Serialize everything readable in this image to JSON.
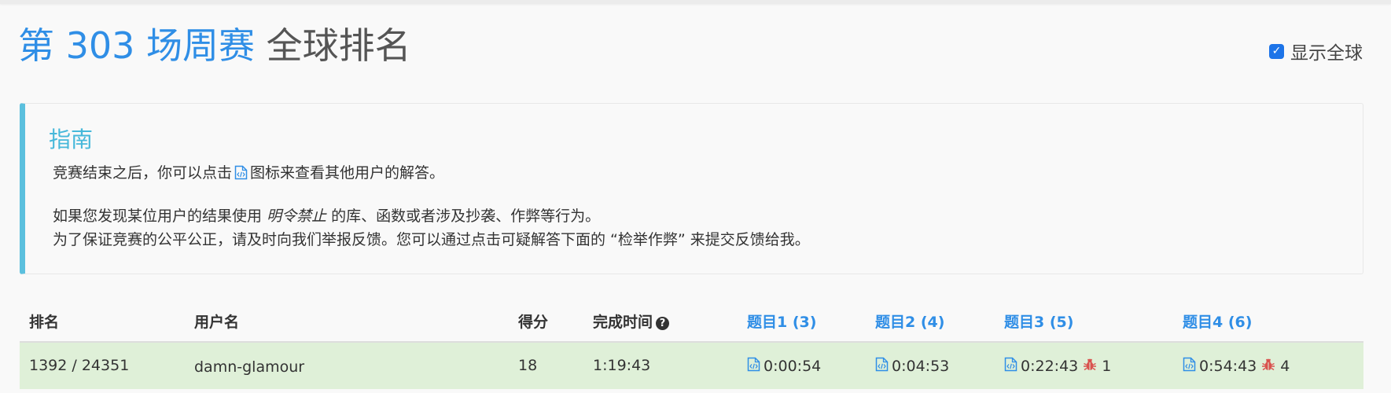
{
  "page": {
    "title_link": "第 303 场周赛",
    "title_rest": "全球排名",
    "show_global_label": "显示全球",
    "show_global_checked": true
  },
  "guide": {
    "title": "指南",
    "line1_before": "竞赛结束之后，你可以点击",
    "line1_after": "图标来查看其他用户的解答。",
    "line2_before": "如果您发现某位用户的结果使用",
    "line2_em": "明令禁止",
    "line2_after": "的库、函数或者涉及抄袭、作弊等行为。",
    "line3": "为了保证竞赛的公平公正，请及时向我们举报反馈。您可以通过点击可疑解答下面的 “检举作弊” 来提交反馈给我。"
  },
  "table": {
    "headers": {
      "rank": "排名",
      "username": "用户名",
      "score": "得分",
      "finish_time": "完成时间",
      "q1": "题目1 (3)",
      "q2": "题目2 (4)",
      "q3": "题目3 (5)",
      "q4": "题目4 (6)"
    },
    "rows": [
      {
        "rank": "1392 / 24351",
        "username": "damn-glamour",
        "score": "18",
        "finish_time": "1:19:43",
        "q1_time": "0:00:54",
        "q2_time": "0:04:53",
        "q3_time": "0:22:43",
        "q3_bugs": "1",
        "q4_time": "0:54:43",
        "q4_bugs": "4"
      }
    ]
  },
  "colors": {
    "link": "#2f8ee6",
    "guide_accent": "#5bc0de",
    "row_success": "#dff0d8",
    "bug": "#d9534f",
    "checkbox": "#1d74e8"
  },
  "icons": [
    "code-file-icon",
    "question-circle-icon",
    "bug-icon",
    "check-icon"
  ]
}
